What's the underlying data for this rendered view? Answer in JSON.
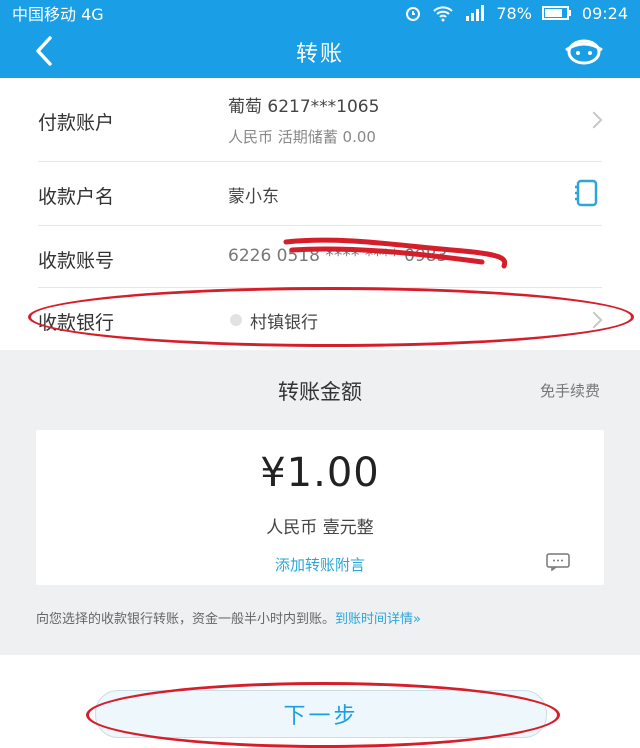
{
  "status_bar": {
    "carrier": "中国移动 4G",
    "battery": "78%",
    "time": "09:24"
  },
  "nav": {
    "title": "转账",
    "back_icon": "chevron-left-icon",
    "service_icon": "customer-service-icon"
  },
  "form": {
    "payer": {
      "label": "付款账户",
      "account": "葡萄 6217***1065",
      "detail": "人民币 活期储蓄 0.00"
    },
    "payee_name": {
      "label": "收款户名",
      "value": "蒙小东",
      "icon": "contacts-icon"
    },
    "payee_account": {
      "label": "收款账号",
      "value": "6226 0518 **** **** 0983"
    },
    "payee_bank": {
      "label": "收款银行",
      "value": "村镇银行"
    }
  },
  "amount_section": {
    "title": "转账金额",
    "fee": "免手续费",
    "amount": "¥1.00",
    "amount_cn": "人民币 壹元整",
    "add_note": "添加转账附言",
    "notice": "向您选择的收款银行转账，资金一般半小时内到账。",
    "notice_link": "到账时间详情»"
  },
  "next_button": "下一步",
  "colors": {
    "header": "#1a9ee6",
    "accent_link": "#2aa7d8",
    "annotation_red": "#d61e2b"
  }
}
